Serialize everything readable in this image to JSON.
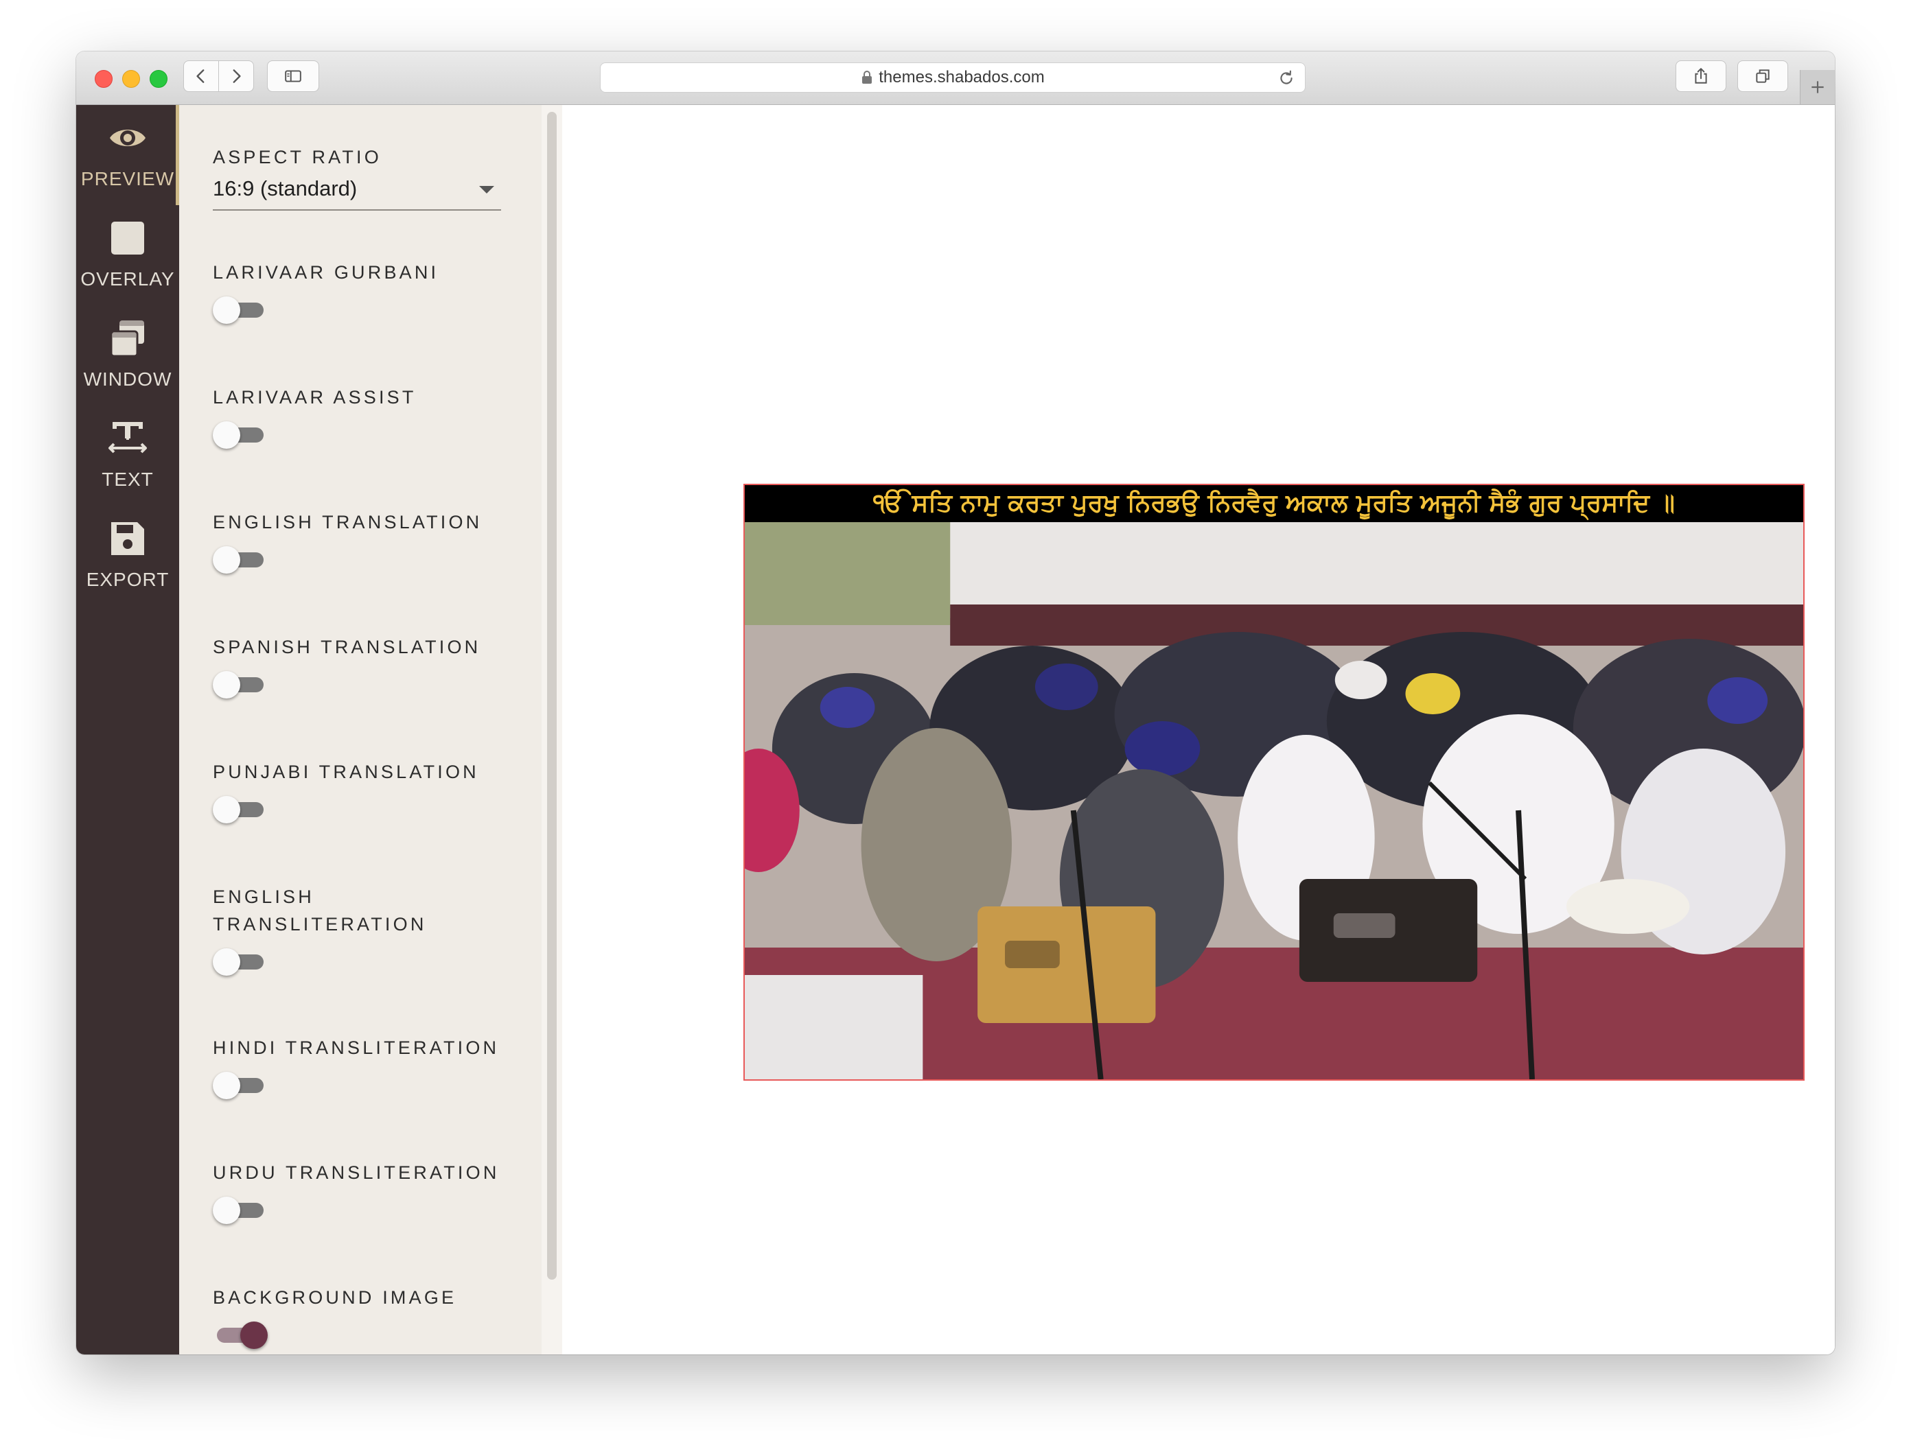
{
  "browser": {
    "url": "themes.shabados.com"
  },
  "nav_rail": {
    "items": [
      {
        "label": "PREVIEW",
        "icon": "eye-icon",
        "active": true
      },
      {
        "label": "OVERLAY",
        "icon": "square-icon",
        "active": false
      },
      {
        "label": "WINDOW",
        "icon": "windows-icon",
        "active": false
      },
      {
        "label": "TEXT",
        "icon": "text-height-icon",
        "active": false
      },
      {
        "label": "EXPORT",
        "icon": "floppy-disk-icon",
        "active": false
      }
    ]
  },
  "settings": {
    "aspect_ratio": {
      "label": "ASPECT RATIO",
      "value": "16:9 (standard)"
    },
    "toggles": [
      {
        "label": "LARIVAAR GURBANI",
        "on": false
      },
      {
        "label": "LARIVAAR ASSIST",
        "on": false
      },
      {
        "label": "ENGLISH TRANSLATION",
        "on": false
      },
      {
        "label": "SPANISH TRANSLATION",
        "on": false
      },
      {
        "label": "PUNJABI TRANSLATION",
        "on": false
      },
      {
        "label": "ENGLISH TRANSLITERATION",
        "on": false
      },
      {
        "label": "HINDI TRANSLITERATION",
        "on": false
      },
      {
        "label": "URDU TRANSLITERATION",
        "on": false
      },
      {
        "label": "BACKGROUND IMAGE",
        "on": true
      }
    ]
  },
  "preview": {
    "gurbani_line": "ੴ ਸਤਿ ਨਾਮੁ ਕਰਤਾ ਪੁਰਖੁ ਨਿਰਭਉ ਨਿਰਵੈਰੁ ਅਕਾਲ ਮੂਰਤਿ ਅਜੂਨੀ ਸੈਭੰ ਗੁਰ ਪ੍ਰਸਾਦਿ ॥"
  },
  "colors": {
    "rail_bg": "#3b2f30",
    "rail_active": "#d8c7a7",
    "settings_bg": "#f0ece6",
    "toggle_on": "#6b3448",
    "gurbani_text": "#f4c23a",
    "preview_border": "#e85a5a"
  }
}
